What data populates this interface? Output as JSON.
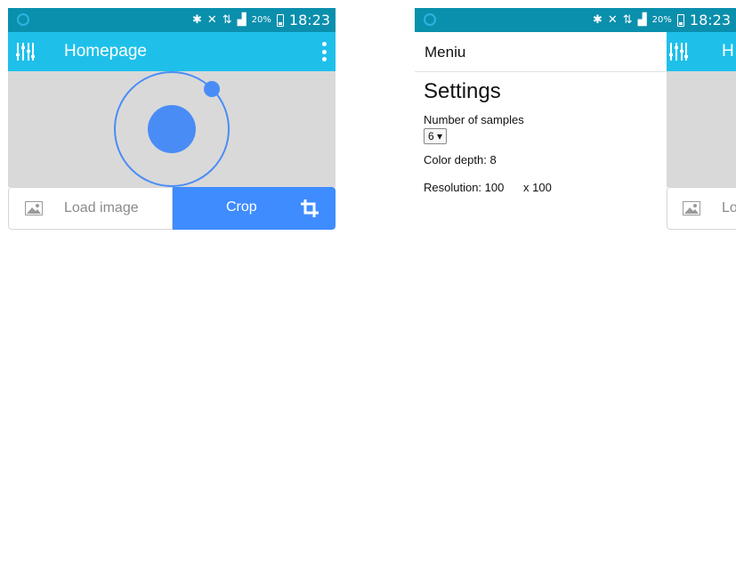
{
  "status_bar": {
    "clock": "18:23",
    "battery_percent": "20%",
    "icons": [
      "bluetooth-icon",
      "mute-icon",
      "network-type-icon",
      "signal-icon",
      "battery-icon"
    ]
  },
  "home": {
    "title": "Homepage",
    "load_label": "Load image",
    "crop_label": "Crop",
    "colors": {
      "header": "#1ec0ea",
      "status": "#0a8fad",
      "crop": "#3f8cff",
      "logo": "#4a8cf6"
    }
  },
  "menu": {
    "title": "Meniu",
    "heading": "Settings",
    "samples_label": "Number of samples",
    "samples_value": "6 ▾",
    "color_depth_label": "Color depth:",
    "color_depth_value": "8",
    "resolution_label": "Resolution:",
    "resolution_w": "100",
    "resolution_h": "x 100"
  },
  "behind": {
    "title_partial": "H",
    "load_partial": "Lo"
  }
}
